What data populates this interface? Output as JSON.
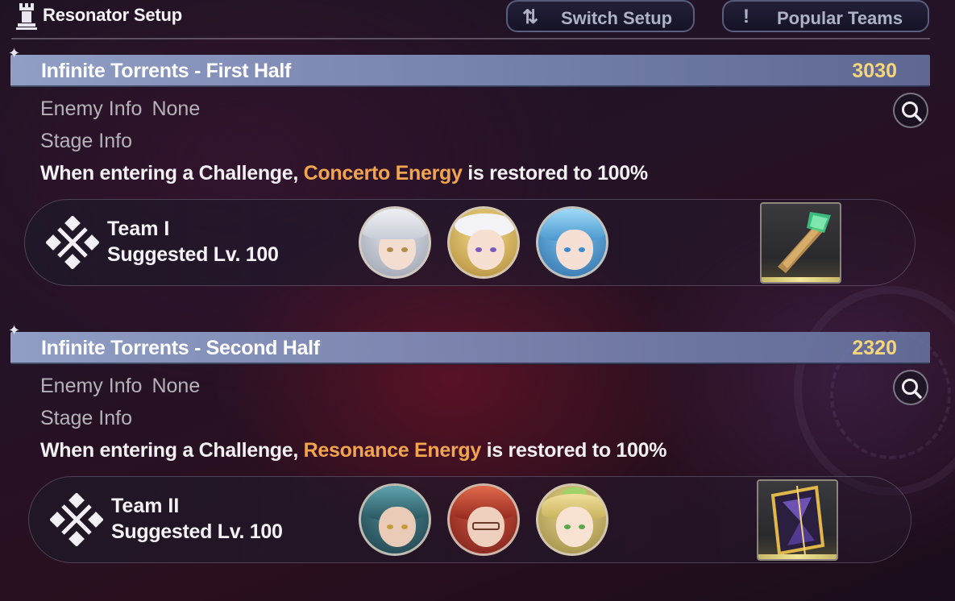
{
  "header": {
    "title": "Resonator Setup",
    "switch_label": "Switch Setup",
    "switch_icon": "swap-arrows-icon",
    "popular_label": "Popular Teams",
    "popular_icon": "exclamation-icon"
  },
  "sections": [
    {
      "title": "Infinite Torrents - First Half",
      "score": "3030",
      "enemy_label": "Enemy Info",
      "enemy_value": "None",
      "stage_label": "Stage Info",
      "effect_prefix": "When entering a Challenge, ",
      "effect_highlight": "Concerto Energy",
      "effect_suffix": " is restored to 100%",
      "team": {
        "name": "Team I",
        "level": "Suggested Lv. 100",
        "members": [
          "silver-haired-resonator",
          "blonde-resonator-white-hat",
          "blue-haired-resonator"
        ],
        "echo": "green-blade-echo-item"
      }
    },
    {
      "title": "Infinite Torrents - Second Half",
      "score": "2320",
      "enemy_label": "Enemy Info",
      "enemy_value": "None",
      "stage_label": "Stage Info",
      "effect_prefix": "When entering a Challenge, ",
      "effect_highlight": "Resonance Energy",
      "effect_suffix": " is restored to 100%",
      "team": {
        "name": "Team II",
        "level": "Suggested Lv. 100",
        "members": [
          "teal-haired-resonator",
          "red-haired-resonator-glasses",
          "blonde-resonator-green-bow"
        ],
        "echo": "golden-hourglass-echo-item"
      }
    }
  ],
  "colors": {
    "accent_orange": "#f3a44e",
    "score_gold": "#f6d67a",
    "banner": "#96a5cd"
  }
}
